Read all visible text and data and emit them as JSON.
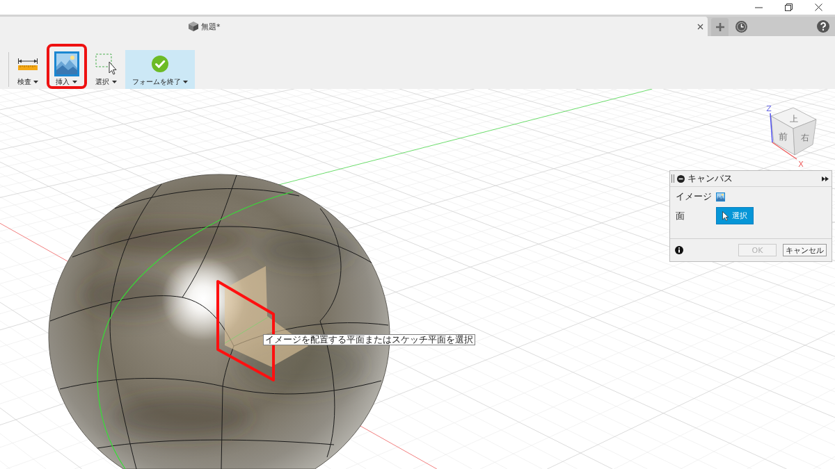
{
  "tabs": [
    {
      "label": "無題*",
      "selected": true
    }
  ],
  "toolbar": {
    "items": [
      {
        "kind": "measure",
        "label": "検査",
        "callout": false,
        "emphasized": false
      },
      {
        "kind": "image",
        "label": "挿入",
        "callout": true,
        "emphasized": false
      },
      {
        "kind": "select",
        "label": "選択",
        "callout": false,
        "emphasized": false
      },
      {
        "kind": "finish",
        "label": "フォームを終了",
        "callout": false,
        "emphasized": true
      }
    ]
  },
  "viewport": {
    "view_cube": {
      "top": "上",
      "front": "前",
      "right": "右",
      "z_label": "Z",
      "x_label": "X"
    },
    "tooltip": "イメージを配置する平面またはスケッチ平面を選択"
  },
  "panel": {
    "title": "キャンバス",
    "rows": [
      {
        "kind": "image",
        "label": "イメージ"
      },
      {
        "kind": "select",
        "label": "面",
        "button": "選択",
        "active": true
      }
    ],
    "buttons": [
      {
        "label": "OK",
        "disabled": true
      },
      {
        "label": "キャンセル",
        "disabled": false
      }
    ]
  }
}
